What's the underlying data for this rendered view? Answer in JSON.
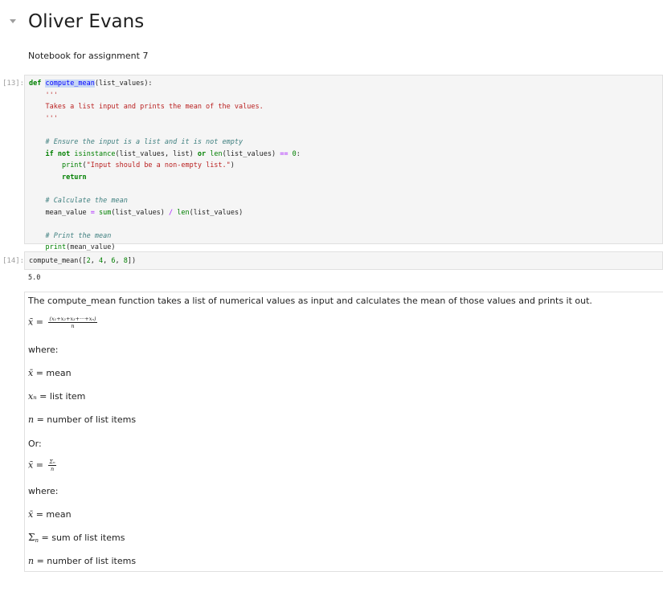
{
  "notebook": {
    "title": "Oliver Evans",
    "subtitle": "Notebook for assignment 7"
  },
  "cells": {
    "code1": {
      "prompt": "[13]:",
      "func_name": "compute_mean",
      "lines": {
        "l1_def": "def",
        "l1_sig": "(list_values):",
        "l2_quote": "    '''",
        "l3_doc": "    Takes a list input and prints the mean of the values.",
        "l4_quote": "    '''",
        "l6_comment": "    # Ensure the input is a list and it is not empty",
        "l7_if": "if",
        "l7_not": "not",
        "l7_isinst": "isinstance",
        "l7_args": "(list_values, list)",
        "l7_or": "or",
        "l7_len": "len",
        "l7_args2": "(list_values)",
        "l7_eq": "==",
        "l7_zero": "0",
        "l7_colon": ":",
        "l8_print": "print",
        "l8_str": "\"Input should be a non-empty list.\"",
        "l9_return": "return",
        "l11_comment": "    # Calculate the mean",
        "l12_var": "    mean_value",
        "l12_eq": "=",
        "l12_sum": "sum",
        "l12_args": "(list_values)",
        "l12_div": "/",
        "l12_len": "len",
        "l12_args2": "(list_values)",
        "l14_comment": "    # Print the mean",
        "l15_print": "print",
        "l15_args": "(mean_value)"
      }
    },
    "code2": {
      "prompt": "[14]:",
      "call_name": "compute_mean",
      "call_open": "([",
      "args": [
        "2",
        "4",
        "6",
        "8"
      ],
      "call_close": "])",
      "output": "5.0"
    },
    "markdown": {
      "intro": "The compute_mean function takes a list of numerical values as input and calculates the mean of those values and prints it out.",
      "formula1_lhs": "x̄ =",
      "formula1_num": "(x₁+x₂+x₃+···+xₙ)",
      "formula1_den": "n",
      "where1": "where:",
      "def_xbar_sym": "x̄",
      "def_xbar_text": " = mean",
      "def_xn_sym": "xₙ",
      "def_xn_text": " = list item",
      "def_n_sym": "n",
      "def_n_text": " = number of list items",
      "or": "Or:",
      "formula2_lhs": "x̄ =",
      "formula2_num": "Σₙ",
      "formula2_den": "n",
      "where2": "where:",
      "def2_xbar_sym": "x̄",
      "def2_xbar_text": " = mean",
      "def2_sigma_sym": "Σ",
      "def2_sigma_sub": "n",
      "def2_sigma_text": " = sum of list items",
      "def2_n_sym": "n",
      "def2_n_text": " = number of list items"
    }
  }
}
